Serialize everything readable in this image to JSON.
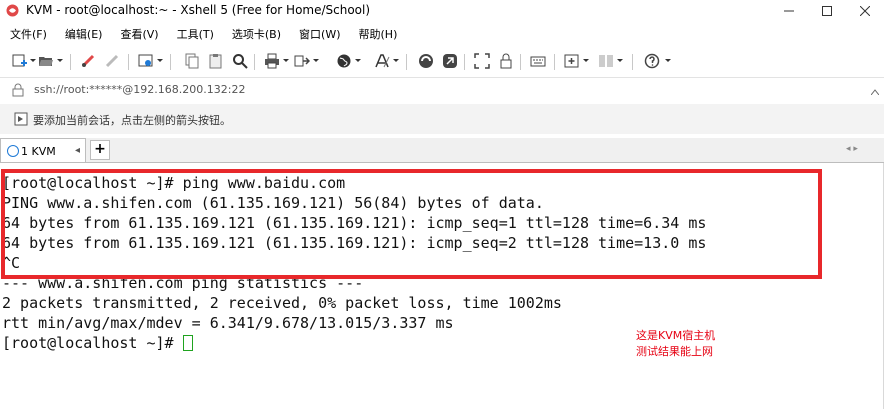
{
  "window": {
    "title": "KVM - root@localhost:~ - Xshell 5 (Free for Home/School)",
    "controls": [
      "minimize-icon",
      "maximize-icon",
      "close-icon"
    ]
  },
  "menu": {
    "items": [
      "文件(F)",
      "编辑(E)",
      "查看(V)",
      "工具(T)",
      "选项卡(B)",
      "窗口(W)",
      "帮助(H)"
    ]
  },
  "toolbar": {
    "icons": [
      "new-session-icon",
      "open-folder-icon",
      "connect-icon",
      "disconnect-icon",
      "properties-icon",
      "copy-icon",
      "paste-icon",
      "find-icon",
      "print-icon",
      "transfer-icon",
      "globe-icon",
      "font-icon",
      "xftp-icon",
      "xmanager-icon",
      "fullscreen-icon",
      "lock-icon",
      "keyboard-icon",
      "add-window-icon",
      "layout-icon",
      "help-icon"
    ]
  },
  "address": {
    "value": "ssh://root:******@192.168.200.132:22"
  },
  "hint": {
    "text": "要添加当前会话，点击左侧的箭头按钮。"
  },
  "tabs": {
    "items": [
      {
        "number": "1",
        "label": "KVM"
      }
    ],
    "add_label": "+"
  },
  "terminal": {
    "lines": [
      "[root@localhost ~]# ping www.baidu.com",
      "PING www.a.shifen.com (61.135.169.121) 56(84) bytes of data.",
      "64 bytes from 61.135.169.121 (61.135.169.121): icmp_seq=1 ttl=128 time=6.34 ms",
      "64 bytes from 61.135.169.121 (61.135.169.121): icmp_seq=2 ttl=128 time=13.0 ms",
      "^C",
      "--- www.a.shifen.com ping statistics ---",
      "2 packets transmitted, 2 received, 0% packet loss, time 1002ms",
      "rtt min/avg/max/mdev = 6.341/9.678/13.015/3.337 ms"
    ],
    "prompt": "[root@localhost ~]# "
  },
  "annotation": {
    "line1": "这是KVM宿主机",
    "line2": "测试结果能上网",
    "box_color": "#e8282b",
    "text_color": "#e60012"
  },
  "colors": {
    "accent": "#1f7ad6",
    "cursor": "#1fa31f"
  }
}
